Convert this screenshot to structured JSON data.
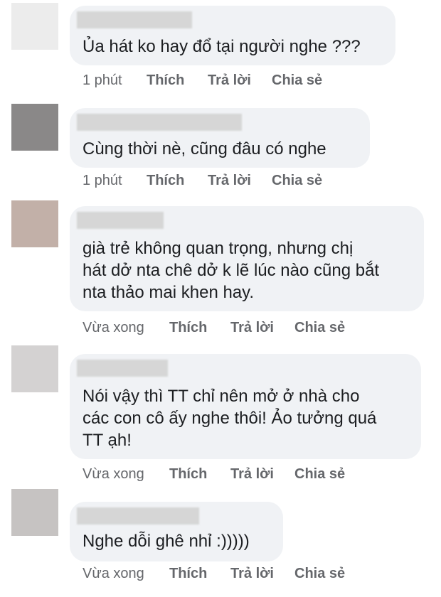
{
  "actions": {
    "like": "Thích",
    "reply": "Trả lời",
    "share": "Chia sẻ"
  },
  "comments": [
    {
      "text": "Ủa hát ko hay đổ tại người nghe ???",
      "time": "1 phút",
      "avatar_color": "#ececec"
    },
    {
      "text": "Cùng thời nè, cũng đâu có nghe",
      "time": "1 phút",
      "avatar_color": "#8a8888"
    },
    {
      "text": "già trẻ không quan trọng, nhưng chị\nhát dở nta chê dở k lẽ lúc nào cũng bắt\nnta thảo mai khen hay.",
      "time": "Vừa xong",
      "avatar_color": "#c2b0a8"
    },
    {
      "text": "Nói vậy thì TT chỉ nên mở ở nhà cho\ncác con cô ấy nghe thôi! Ảo tưởng quá\nTT ạh!",
      "time": "Vừa xong",
      "avatar_color": "#d4d2d2"
    },
    {
      "text": "Nghe dỗi ghê nhỉ :)))))",
      "time": "Vừa xong",
      "avatar_color": "#c6c3c2"
    }
  ]
}
